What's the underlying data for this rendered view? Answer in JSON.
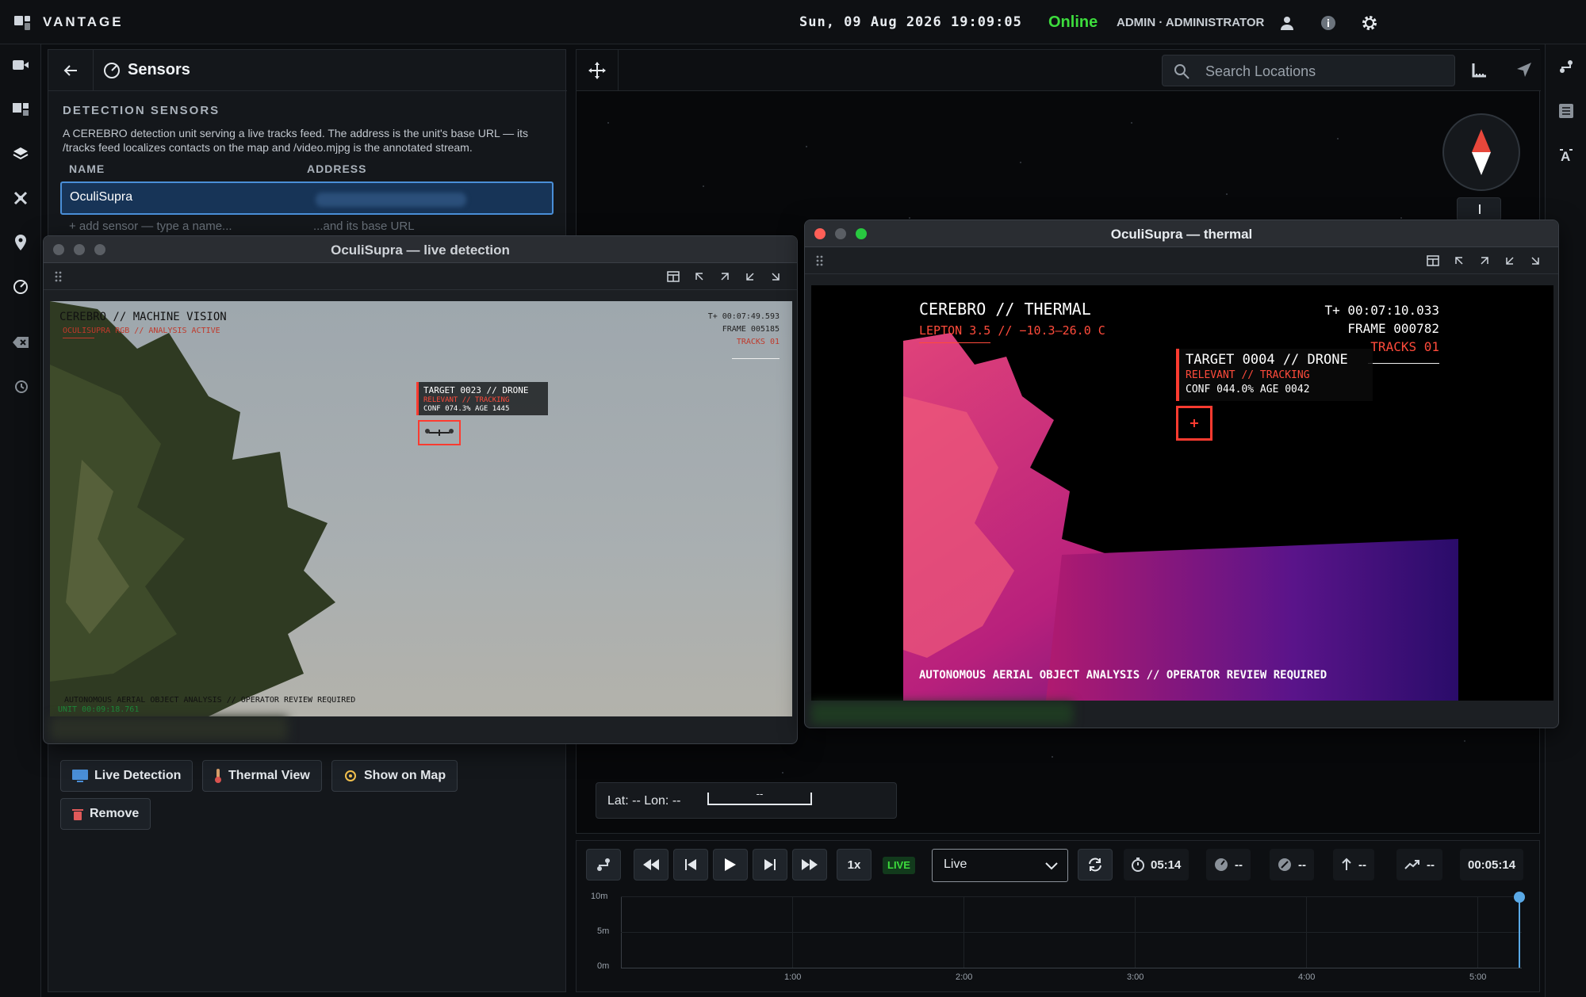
{
  "app": {
    "brand": "VANTAGE",
    "datetime": "Sun, 09 Aug 2026 19:09:05",
    "status": "Online",
    "user": "ADMIN · ADMINISTRATOR"
  },
  "panel": {
    "title": "Sensors",
    "section_title": "DETECTION SENSORS",
    "description": "A CEREBRO detection unit serving a live tracks feed. The address is the unit's base URL — its /tracks feed localizes contacts on the map and /video.mjpg is the annotated stream.",
    "columns": [
      "NAME",
      "ADDRESS"
    ],
    "sensors": [
      {
        "name": "OculiSupra"
      }
    ],
    "add_name_placeholder": "+ add sensor — type a name...",
    "add_url_placeholder": "...and its base URL",
    "buttons": {
      "live_detection": "Live Detection",
      "thermal_view": "Thermal View",
      "show_on_map": "Show on Map",
      "remove": "Remove"
    }
  },
  "map": {
    "search_placeholder": "Search Locations",
    "latlon": "Lat: -- Lon: --",
    "scale_label": "--"
  },
  "live_window": {
    "title": "OculiSupra — live detection",
    "header": "CEREBRO // MACHINE VISION",
    "subheader": "OCULISUPRA RGB // ANALYSIS ACTIVE",
    "t_plus": "T+ 00:07:49.593",
    "frame": "FRAME 005185",
    "tracks": "TRACKS 01",
    "target_title": "TARGET 0023 // DRONE",
    "target_status": "RELEVANT // TRACKING",
    "target_conf": "CONF 074.3%  AGE 1445",
    "footer": "AUTONOMOUS AERIAL OBJECT ANALYSIS // OPERATOR REVIEW REQUIRED",
    "unit_time": "UNIT 00:09:18.761"
  },
  "thermal_window": {
    "title": "OculiSupra — thermal",
    "header": "CEREBRO // THERMAL",
    "subheader": "LEPTON 3.5 // −10.3–26.0 C",
    "t_plus": "T+ 00:07:10.033",
    "frame": "FRAME 000782",
    "tracks": "TRACKS 01",
    "target_title": "TARGET 0004 // DRONE",
    "target_status": "RELEVANT // TRACKING",
    "target_conf": "CONF 044.0%  AGE 0042",
    "footer": "AUTONOMOUS AERIAL OBJECT ANALYSIS // OPERATOR REVIEW REQUIRED"
  },
  "timeline": {
    "speed": "1x",
    "live_badge": "LIVE",
    "mode_select": "Live",
    "stats": {
      "duration": "05:14",
      "s2": "--",
      "s3": "--",
      "s4": "--",
      "s5": "--"
    },
    "current_time": "00:05:14",
    "y_ticks": [
      "10m",
      "5m",
      "0m"
    ],
    "x_ticks": [
      "1:00",
      "2:00",
      "3:00",
      "4:00",
      "5:00"
    ]
  },
  "colors": {
    "accent": "#4a8fd8",
    "online": "#3ddc3d",
    "alert": "#ff3b30",
    "live": "#3ddc3d"
  }
}
